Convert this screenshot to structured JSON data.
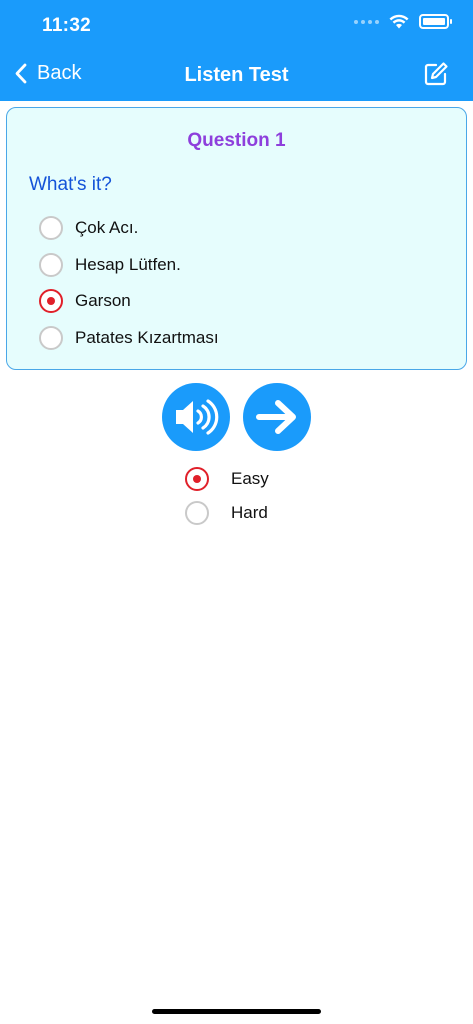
{
  "status": {
    "time": "11:32"
  },
  "nav": {
    "back_label": "Back",
    "title": "Listen Test"
  },
  "card": {
    "question_title": "Question 1",
    "prompt": "What's it?",
    "options": [
      {
        "label": "Çok Acı.",
        "selected": false
      },
      {
        "label": "Hesap Lütfen.",
        "selected": false
      },
      {
        "label": "Garson",
        "selected": true
      },
      {
        "label": "Patates Kızartması",
        "selected": false
      }
    ]
  },
  "controls": {
    "play_icon": "speaker-icon",
    "next_icon": "arrow-right-icon"
  },
  "levels": [
    {
      "label": "Easy",
      "selected": true
    },
    {
      "label": "Hard",
      "selected": false
    }
  ],
  "colors": {
    "primary": "#1a9bfb",
    "card_bg": "#e6fdfd",
    "question_title": "#8e3fdc",
    "prompt": "#1453d8",
    "radio_selected": "#e0202a"
  }
}
